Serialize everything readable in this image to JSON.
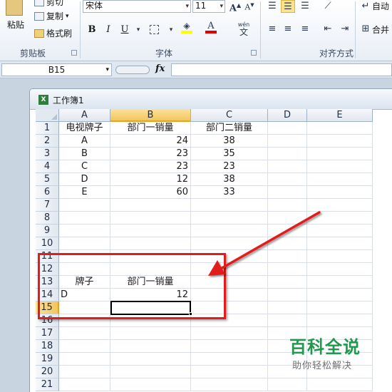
{
  "ribbon": {
    "clipboard": {
      "paste": "粘贴",
      "cut": "剪切",
      "copy": "复制",
      "format_painter": "格式刷",
      "group_label": "剪贴板"
    },
    "font": {
      "font_name": "宋体",
      "font_size": "11",
      "bold": "B",
      "italic": "I",
      "underline": "U",
      "wen": "wén",
      "group_label": "字体"
    },
    "alignment": {
      "wrap_text": "自动",
      "merge_center": "合并",
      "group_label": "对齐方式"
    }
  },
  "formula_bar": {
    "name_box": "B15",
    "fx": "fx",
    "formula": ""
  },
  "workbook": {
    "title": "工作簿1",
    "columns": [
      "A",
      "B",
      "C",
      "D",
      "E"
    ],
    "selected_column": "B",
    "rows": [
      "1",
      "2",
      "3",
      "4",
      "5",
      "6",
      "7",
      "8",
      "9",
      "10",
      "11",
      "12",
      "13",
      "14",
      "15",
      "16",
      "17",
      "18",
      "19",
      "20",
      "21"
    ],
    "selected_row": "15",
    "active_cell": "B15",
    "cells": {
      "A1": "电视牌子",
      "B1": "部门一销量",
      "C1": "部门二销量",
      "A2": "A",
      "B2": "24",
      "C2": "38",
      "A3": "B",
      "B3": "23",
      "C3": "35",
      "A4": "C",
      "B4": "23",
      "C4": "23",
      "A5": "D",
      "B5": "12",
      "C5": "38",
      "A6": "E",
      "B6": "60",
      "C6": "33",
      "A13": "牌子",
      "B13": "部门一销量",
      "A14": "D",
      "B14": "12"
    }
  },
  "annotation": {
    "box_color": "#e21b1b",
    "arrow_color": "#e21b1b"
  },
  "watermark": {
    "main": "百科全说",
    "sub": "助你轻松解决",
    "color": "#1f9a4d"
  }
}
